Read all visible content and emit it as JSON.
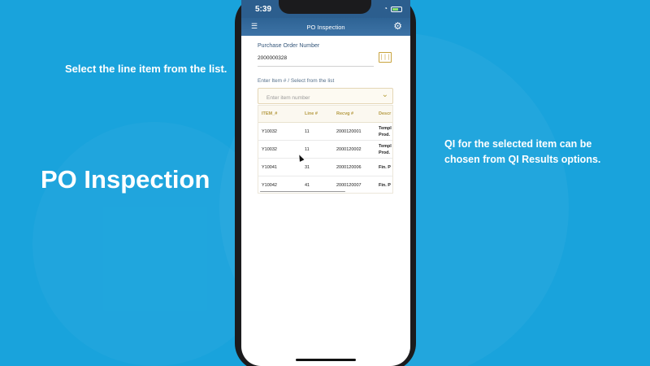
{
  "slide": {
    "caption_left": "Select the line item from the list.",
    "title": "PO Inspection",
    "caption_right": "QI for the selected item can be chosen from QI Results options."
  },
  "phone": {
    "status": {
      "time": "5:39"
    },
    "nav": {
      "title": "PO Inspection",
      "menu_icon": "menu-icon",
      "settings_icon": "gear-icon"
    },
    "form": {
      "po_label": "Purchase Order Number",
      "po_value": "2000000328",
      "scan_icon": "barcode-scan-icon",
      "item_label": "Enter Item # / Select from the list",
      "item_placeholder": "Enter item number",
      "item_value": ""
    },
    "table": {
      "headers": [
        "ITEM_#",
        "Line #",
        "Recvg #",
        "Descr"
      ],
      "rows": [
        {
          "item": "Y10032",
          "line": "11",
          "recvg": "2000120001",
          "desc1": "Templ",
          "desc2": "Prod."
        },
        {
          "item": "Y10032",
          "line": "11",
          "recvg": "2000120002",
          "desc1": "Templ",
          "desc2": "Prod."
        },
        {
          "item": "Y10041",
          "line": "31",
          "recvg": "2000120006",
          "desc1": "Fin. P",
          "desc2": ""
        },
        {
          "item": "Y10042",
          "line": "41",
          "recvg": "2000120007",
          "desc1": "Fin. P",
          "desc2": ""
        }
      ]
    }
  },
  "colors": {
    "background": "#19a3dc",
    "header": "#2e6394",
    "accent_gold": "#b59a42"
  }
}
